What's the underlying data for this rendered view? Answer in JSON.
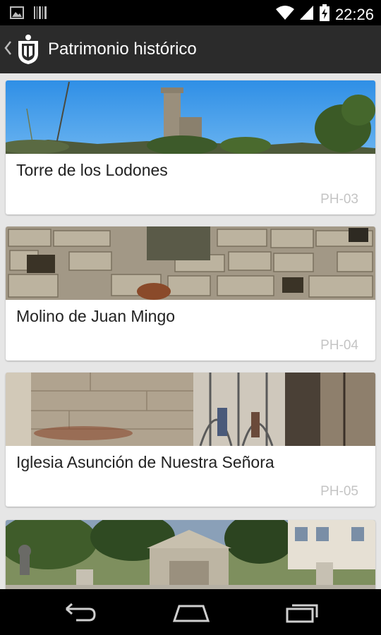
{
  "status_bar": {
    "time": "22:26",
    "icons": [
      "gallery-icon",
      "barcode-icon",
      "wifi-icon",
      "cell-signal-icon",
      "battery-charging-icon"
    ]
  },
  "action_bar": {
    "title": "Patrimonio histórico",
    "icons": [
      "back-chevron-icon",
      "coat-of-arms-icon"
    ]
  },
  "items": [
    {
      "title": "Torre de los Lodones",
      "code": "PH-03",
      "image": "tower-photo"
    },
    {
      "title": "Molino de Juan Mingo",
      "code": "PH-04",
      "image": "stone-wall-photo"
    },
    {
      "title": "Iglesia Asunción de Nuestra Señora",
      "code": "PH-05",
      "image": "church-facade-photo"
    },
    {
      "title": "",
      "code": "",
      "image": "fountain-monument-photo"
    }
  ],
  "nav_bar": {
    "icons": [
      "back-icon",
      "home-icon",
      "recent-apps-icon"
    ]
  }
}
